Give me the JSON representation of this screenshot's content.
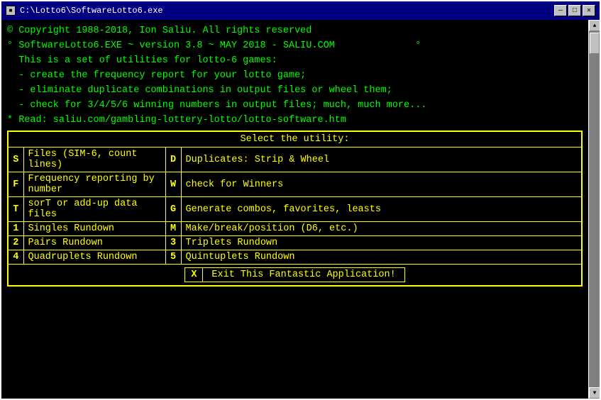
{
  "window": {
    "title": "C:\\Lotto6\\SoftwareLotto6.exe",
    "icon_label": "■"
  },
  "titlebar": {
    "minimize": "—",
    "maximize": "□",
    "close": "✕"
  },
  "terminal": {
    "lines": [
      "© Copyright 1988-2018, Ion Saliu. All rights reserved",
      "° SoftwareLotto6.EXE ~ version 3.8 ~ MAY 2018 - SALIU.COM              °",
      "  This is a set of utilities for lotto-6 games:",
      "  - create the frequency report for your lotto game;",
      "  - eliminate duplicate combinations in output files or wheel them;",
      "  - check for 3/4/5/6 winning numbers in output files; much, much more...",
      "* Read: saliu.com/gambling-lottery-lotto/lotto-software.htm"
    ]
  },
  "menu": {
    "header": "Select the utility:",
    "rows": [
      {
        "key1": "S",
        "label1": "Files (SIM-6, count lines)",
        "key2": "D",
        "label2": "Duplicates: Strip & Wheel"
      },
      {
        "key1": "F",
        "label1": "Frequency reporting by number",
        "key2": "W",
        "label2": "check for Winners"
      },
      {
        "key1": "T",
        "label1": "sorT or add-up data files",
        "key2": "G",
        "label2": "Generate combos, favorites, leasts"
      },
      {
        "key1": "1",
        "label1": "Singles Rundown",
        "key2": "M",
        "label2": "Make/break/position (D6, etc.)"
      },
      {
        "key1": "2",
        "label1": "Pairs Rundown",
        "key2": "3",
        "label2": "Triplets Rundown"
      },
      {
        "key1": "4",
        "label1": "Quadruplets Rundown",
        "key2": "5",
        "label2": "Quintuplets Rundown"
      }
    ],
    "exit_key": "X",
    "exit_label": "Exit This Fantastic Application!"
  }
}
